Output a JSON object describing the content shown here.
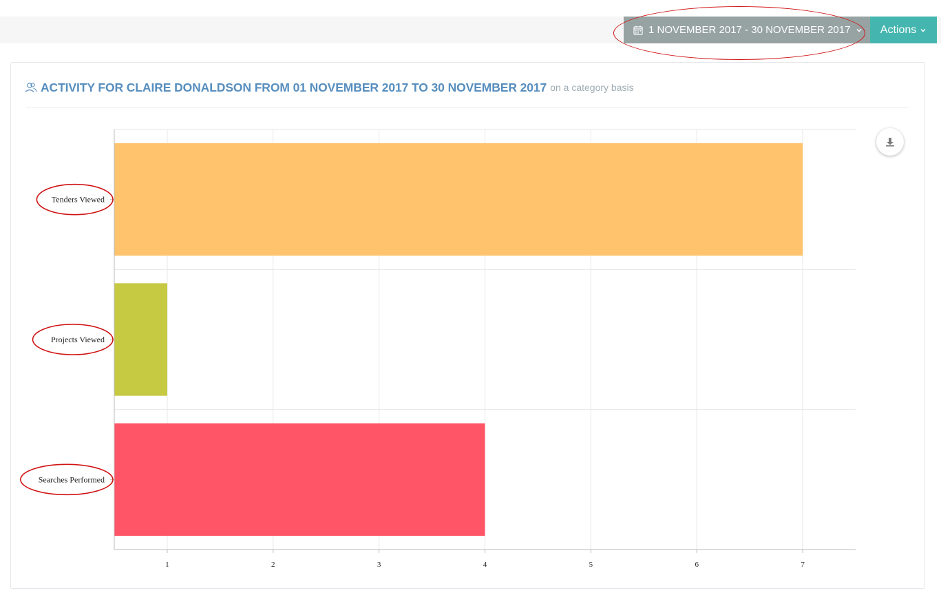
{
  "toolbar": {
    "date_range": "1 NOVEMBER 2017 - 30 NOVEMBER 2017",
    "actions_label": "Actions"
  },
  "panel": {
    "title": "ACTIVITY FOR CLAIRE DONALDSON FROM 01 NOVEMBER 2017 TO 30 NOVEMBER 2017",
    "subtitle": "on a category basis"
  },
  "colors": {
    "title": "#578ebe",
    "date_button": "#97a3a3",
    "actions_button": "#45b6af",
    "annotation": "#d01313"
  },
  "chart_data": {
    "type": "bar",
    "orientation": "horizontal",
    "categories": [
      "Tenders Viewed",
      "Projects Viewed",
      "Searches Performed"
    ],
    "values": [
      7,
      1,
      4
    ],
    "colors": [
      "#ffc36d",
      "#c6c942",
      "#ff5566"
    ],
    "x_ticks": [
      1,
      2,
      3,
      4,
      5,
      6,
      7
    ],
    "xlim": [
      0.5,
      7.5
    ],
    "grid": true,
    "legend": "none"
  }
}
